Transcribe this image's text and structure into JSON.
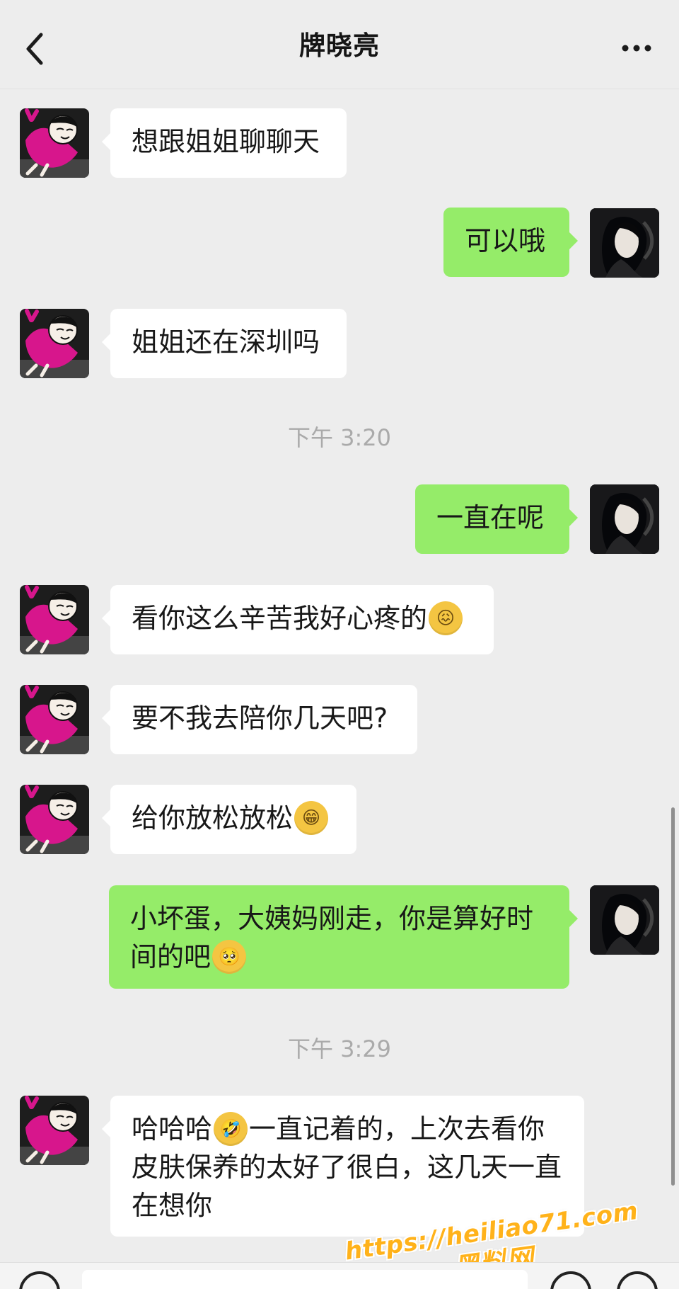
{
  "header": {
    "title": "牌晓亮"
  },
  "messages": [
    {
      "side": "incoming",
      "text": "想跟姐姐聊聊天"
    },
    {
      "side": "outgoing",
      "text": "可以哦"
    },
    {
      "side": "incoming",
      "text": "姐姐还在深圳吗"
    },
    {
      "type": "timestamp",
      "text": "下午 3:20"
    },
    {
      "side": "outgoing",
      "text": "一直在呢"
    },
    {
      "side": "incoming",
      "text": "看你这么辛苦我好心疼的",
      "emoji": "😖"
    },
    {
      "side": "incoming",
      "text": "要不我去陪你几天吧?"
    },
    {
      "side": "incoming",
      "text": "给你放松放松",
      "emoji": "😁"
    },
    {
      "side": "outgoing",
      "text": "小坏蛋，大姨妈刚走，你是算好时间的吧",
      "emoji": "🥺"
    },
    {
      "type": "timestamp",
      "text": "下午 3:29"
    },
    {
      "side": "incoming",
      "text_before": "哈哈哈",
      "emoji": "🤣",
      "text_after": "一直记着的，上次去看你皮肤保养的太好了很白，这几天一直在想你"
    }
  ],
  "watermark": {
    "url": "https://heiliao71.com",
    "name": "黑料网"
  },
  "icons": {
    "back": "back-arrow-icon",
    "more": "more-options-icon",
    "voice": "voice-input-icon",
    "emoji": "emoji-icon",
    "plus": "plus-icon"
  },
  "colors": {
    "background": "#ededed",
    "incoming_bubble": "#ffffff",
    "outgoing_bubble": "#95ec69",
    "watermark": "#ffb21a"
  }
}
